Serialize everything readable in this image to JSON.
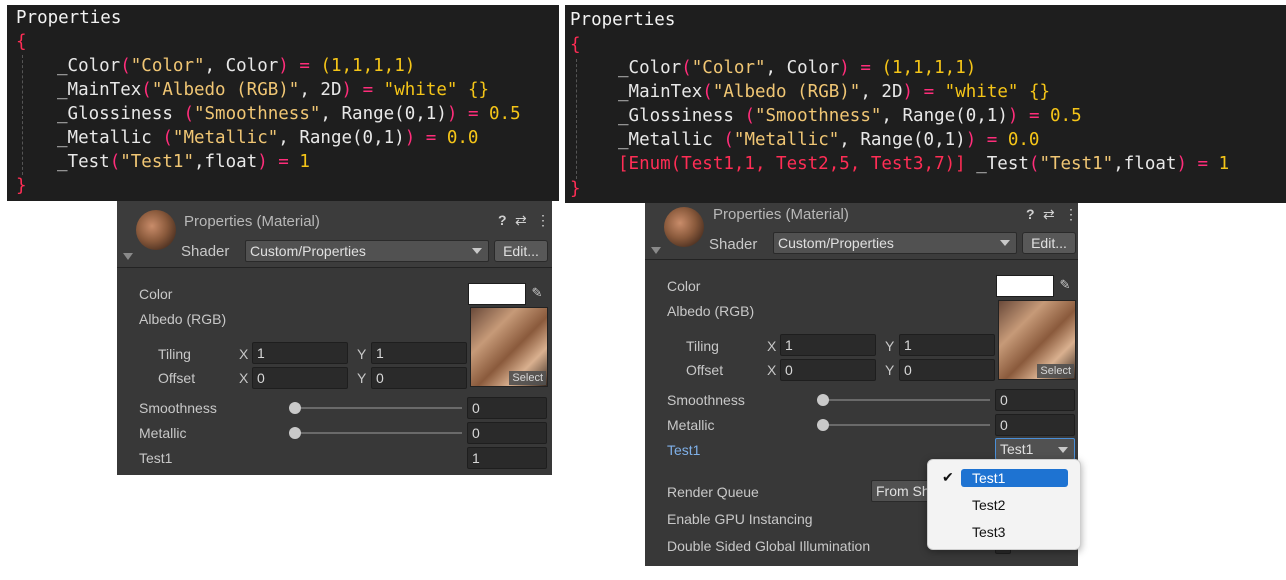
{
  "left_code": {
    "title": "Properties",
    "open_brace": "{",
    "close_brace": "}",
    "lines": [
      {
        "id": "_Color",
        "paren": "(",
        "str": "\"Color\"",
        "rest": ", Color",
        "close": ")",
        "eq": " = ",
        "val": "(1,1,1,1)"
      },
      {
        "id": "_MainTex",
        "paren": "(",
        "str": "\"Albedo (RGB)\"",
        "rest": ", 2D",
        "close": ")",
        "eq": " = ",
        "val": "\"white\" {}"
      },
      {
        "id": "_Glossiness ",
        "paren": "(",
        "str": "\"Smoothness\"",
        "rest": ", Range(0,1)",
        "close": ")",
        "eq": " = ",
        "val": "0.5"
      },
      {
        "id": "_Metallic ",
        "paren": "(",
        "str": "\"Metallic\"",
        "rest": ", Range(0,1)",
        "close": ")",
        "eq": " = ",
        "val": "0.0"
      },
      {
        "id": "_Test",
        "paren": "(",
        "str": "\"Test1\"",
        "rest": ",float",
        "close": ")",
        "eq": " = ",
        "val": "1"
      }
    ]
  },
  "right_code": {
    "title": "Properties",
    "open_brace": "{",
    "close_brace": "}",
    "lines": [
      {
        "id": "_Color",
        "paren": "(",
        "str": "\"Color\"",
        "rest": ", Color",
        "close": ")",
        "eq": " = ",
        "val": "(1,1,1,1)"
      },
      {
        "id": "_MainTex",
        "paren": "(",
        "str": "\"Albedo (RGB)\"",
        "rest": ", 2D",
        "close": ")",
        "eq": " = ",
        "val": "\"white\" {}"
      },
      {
        "id": "_Glossiness ",
        "paren": "(",
        "str": "\"Smoothness\"",
        "rest": ", Range(0,1)",
        "close": ")",
        "eq": " = ",
        "val": "0.5"
      },
      {
        "id": "_Metallic ",
        "paren": "(",
        "str": "\"Metallic\"",
        "rest": ", Range(0,1)",
        "close": ")",
        "eq": " = ",
        "val": "0.0"
      }
    ],
    "enum_attr": "[Enum(Test1,1, Test2,5, Test3,7)]",
    "enum_line": {
      "id": " _Test",
      "paren": "(",
      "str": "\"Test1\"",
      "rest": ",float",
      "close": ")",
      "eq": " = ",
      "val": "1"
    }
  },
  "left_inspector": {
    "title": "Properties (Material)",
    "shader_label": "Shader",
    "shader_value": "Custom/Properties",
    "edit_button": "Edit...",
    "color_label": "Color",
    "albedo_label": "Albedo (RGB)",
    "tiling_label": "Tiling",
    "offset_label": "Offset",
    "x_label": "X",
    "y_label": "Y",
    "tiling_x": "1",
    "tiling_y": "1",
    "offset_x": "0",
    "offset_y": "0",
    "select_label": "Select",
    "smoothness_label": "Smoothness",
    "smoothness_value": "0",
    "metallic_label": "Metallic",
    "metallic_value": "0",
    "test1_label": "Test1",
    "test1_value": "1",
    "help_icon": "?",
    "settings_icon": "⇄",
    "menu_icon": "⋮"
  },
  "right_inspector": {
    "title": "Properties (Material)",
    "shader_label": "Shader",
    "shader_value": "Custom/Properties",
    "edit_button": "Edit...",
    "color_label": "Color",
    "albedo_label": "Albedo (RGB)",
    "tiling_label": "Tiling",
    "offset_label": "Offset",
    "x_label": "X",
    "y_label": "Y",
    "tiling_x": "1",
    "tiling_y": "1",
    "offset_x": "0",
    "offset_y": "0",
    "select_label": "Select",
    "smoothness_label": "Smoothness",
    "smoothness_value": "0",
    "metallic_label": "Metallic",
    "metallic_value": "0",
    "test1_label": "Test1",
    "test1_value": "Test1",
    "render_queue_label": "Render Queue",
    "render_queue_value": "From Sh",
    "gpu_instancing_label": "Enable GPU Instancing",
    "double_sided_label": "Double Sided Global Illumination",
    "help_icon": "?",
    "settings_icon": "⇄",
    "menu_icon": "⋮"
  },
  "enum_popup": {
    "options": [
      "Test1",
      "Test2",
      "Test3"
    ],
    "selected_index": 0,
    "check": "✔"
  },
  "colors": {
    "code_bg": "#1e1e1e",
    "inspector_bg": "#383838",
    "selection": "#1e73d2"
  }
}
